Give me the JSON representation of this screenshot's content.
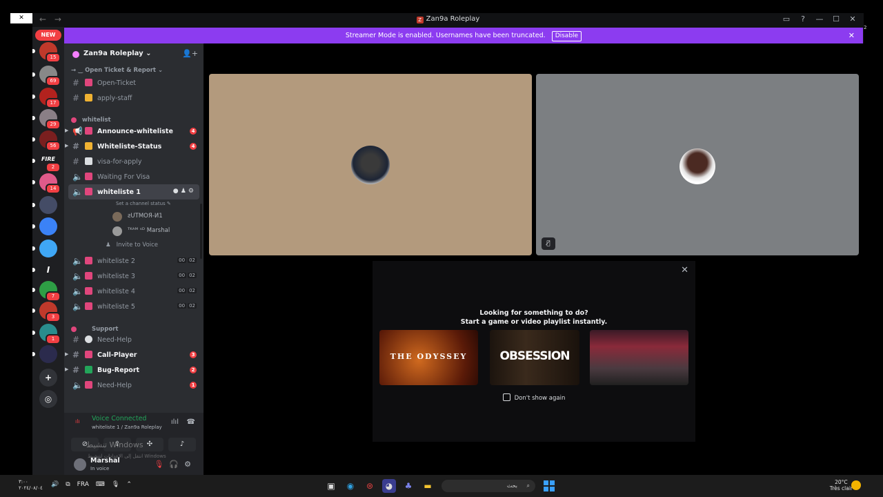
{
  "window": {
    "title": "Zan9a Roleplay",
    "title_logo": "Z",
    "nav_back": "←",
    "nav_fwd": "→",
    "controls": [
      "▭",
      "?",
      "—",
      "☐",
      "✕"
    ]
  },
  "desktop": {
    "left_close": "✕",
    "right_number": "2"
  },
  "banner": {
    "text": "Streamer Mode is enabled. Usernames have been truncated.",
    "disable_label": "Disable",
    "close": "✕"
  },
  "servers": {
    "new_badge": "NEW",
    "items": [
      {
        "name": "server-1",
        "color": "#c0392b",
        "badge": "15"
      },
      {
        "name": "server-2",
        "color": "#888888",
        "badge": "69"
      },
      {
        "name": "server-3",
        "color": "#b2221e",
        "badge": "17"
      },
      {
        "name": "server-4",
        "color": "#8a7f86",
        "badge": "29"
      },
      {
        "name": "server-5",
        "color": "#7a1f1f",
        "badge": "56"
      },
      {
        "name": "server-6",
        "color": "#1e1f22",
        "badge": "2",
        "text": "FIRE"
      },
      {
        "name": "server-7",
        "color": "#e05a8a",
        "badge": "14"
      },
      {
        "name": "server-8",
        "color": "#444c66",
        "badge": ""
      },
      {
        "name": "server-9",
        "color": "#3b82f6",
        "badge": ""
      },
      {
        "name": "server-10",
        "color": "#3fa7f5",
        "badge": ""
      },
      {
        "name": "server-11",
        "color": "#1e1f22",
        "badge": "",
        "text": "I"
      },
      {
        "name": "server-12",
        "color": "#2e9e45",
        "badge": "7"
      },
      {
        "name": "server-13",
        "color": "#c0392b",
        "badge": "3"
      },
      {
        "name": "server-14",
        "color": "#2a8d8d",
        "badge": "1"
      },
      {
        "name": "server-15",
        "color": "#2b2b4d",
        "badge": ""
      },
      {
        "name": "add-server",
        "color": "#313338",
        "badge": "",
        "text": "+"
      },
      {
        "name": "explore",
        "color": "#313338",
        "badge": "",
        "text": "◎"
      }
    ]
  },
  "guild": {
    "name": "Zan9a Roleplay",
    "chevron": "⌄",
    "invite_icon": "👤+"
  },
  "channels": {
    "cat_open_ticket": "→ ‿ Open Ticket & Report ⌄",
    "open_ticket": "Open-Ticket",
    "apply_staff": "apply-staff",
    "cat_whitelist": "whitelist",
    "announce_whiteliste": "Announce-whiteliste",
    "announce_mentions": "4",
    "whiteliste_status": "Whiteliste-Status",
    "status_mentions": "4",
    "visa_for_apply": "visa-for-apply",
    "waiting_for_visa": "Waiting For Visa",
    "whiteliste_1": "whiteliste 1",
    "set_status": "Set a channel status ✎",
    "voice_user_1": "ƨUTMOЯ-И1",
    "voice_user_2": "ᵀᴷᴬᴹ ˢᴰ Marshal",
    "invite_to_voice": "Invite to Voice",
    "whiteliste_2": "whiteliste 2",
    "whiteliste_3": "whiteliste 3",
    "whiteliste_4": "whiteliste 4",
    "whiteliste_5": "whiteliste 5",
    "count_a": "00",
    "count_b": "02",
    "cat_support": "Support",
    "need_help_1": "Need-Help",
    "call_player": "Call-Player",
    "call_mentions": "3",
    "bug_report": "Bug-Report",
    "bug_mentions": "2",
    "need_help_2": "Need-Help",
    "need_help_mentions": "1"
  },
  "voice_panel": {
    "status": "Voice Connected",
    "location": "whiteliste 1 / Zan9a Roleplay",
    "user_name": "Marshal",
    "user_status": "In voice"
  },
  "watermark": {
    "line1": "تنشيط Windows",
    "line2": "انتقل إلى الإعدادات لتنشيط Windows"
  },
  "activity": {
    "line1": "Looking for something to do?",
    "line2": "Start a game or video playlist instantly.",
    "cards": [
      "THE ODYSSEY",
      "OBSESSION",
      ""
    ],
    "dont_show": "Don't show again"
  },
  "taskbar": {
    "time_top": "٣:٠٠",
    "date": "٢٠٢٤/٠٨/٠٤",
    "lang": "FRA",
    "search_text": "بحث",
    "temp": "20°C",
    "weather": "Très clair"
  }
}
